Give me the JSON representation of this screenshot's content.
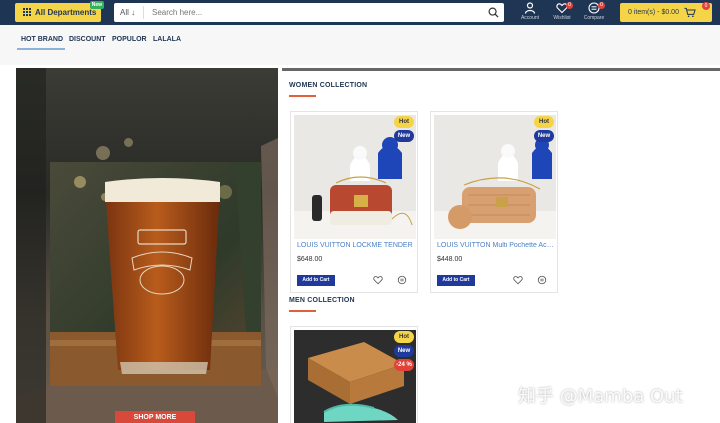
{
  "header": {
    "departments_label": "All Departments",
    "departments_flag": "New",
    "search_scope": "All",
    "search_placeholder": "Search here...",
    "account_label": "Account",
    "wishlist_label": "Wishlist",
    "wishlist_count": "0",
    "compare_label": "Compare",
    "compare_count": "0",
    "cart_text": "0 item(s) - $0.00",
    "cart_count": "0"
  },
  "tabs": [
    {
      "label": "HOT BRAND"
    },
    {
      "label": "DISCOUNT"
    },
    {
      "label": "POPULOR"
    },
    {
      "label": "LALALA"
    }
  ],
  "banner": {
    "button_label": "SHOP MORE"
  },
  "women": {
    "title": "WOMEN COLLECTION",
    "products": [
      {
        "name": "LOUIS VUITTON LOCKME TENDER",
        "price": "$648.00",
        "badges": [
          "Hot",
          "New"
        ],
        "add_label": "Add to Cart"
      },
      {
        "name": "LOUIS VUITTON Multi Pochette Accessoires",
        "price": "$448.00",
        "badges": [
          "Hot",
          "New"
        ],
        "add_label": "Add to Cart"
      }
    ]
  },
  "men": {
    "title": "MEN COLLECTION",
    "products": [
      {
        "badges": [
          "Hot",
          "New",
          "-24 %"
        ]
      }
    ]
  },
  "watermark": "知乎 @Mamba Out",
  "colors": {
    "header_bg": "#1f3554",
    "accent_yellow": "#f5d547",
    "button_blue": "#1f3a9c",
    "section_underline": "#e0603a",
    "link_blue": "#4a7fc4",
    "badge_red": "#e0423a"
  },
  "icons": {
    "search": "search-icon",
    "account": "user-icon",
    "wishlist": "heart-icon",
    "compare": "compare-icon",
    "cart": "cart-icon",
    "card_wishlist": "heart-icon",
    "card_compare": "compare-icon"
  }
}
